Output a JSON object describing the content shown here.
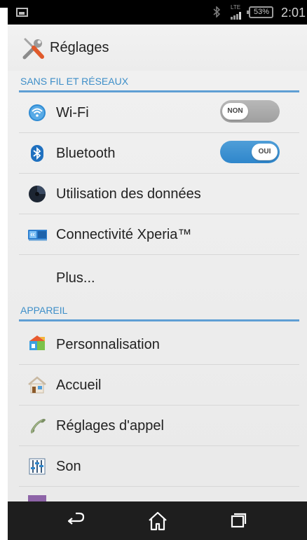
{
  "status_bar": {
    "network": "LTE",
    "battery": "53%",
    "time": "2:01"
  },
  "app_bar": {
    "title": "Réglages",
    "icon": "settings-tools-icon"
  },
  "sections": [
    {
      "header": "SANS FIL ET RÉSEAUX",
      "items": [
        {
          "label": "Wi-Fi",
          "icon": "wifi-icon",
          "toggle": "NON"
        },
        {
          "label": "Bluetooth",
          "icon": "bluetooth-icon",
          "toggle": "OUI"
        },
        {
          "label": "Utilisation des données",
          "icon": "data-usage-icon"
        },
        {
          "label": "Connectivité Xperia™",
          "icon": "xperia-connectivity-icon"
        },
        {
          "label": "Plus...",
          "icon": ""
        }
      ]
    },
    {
      "header": "APPAREIL",
      "items": [
        {
          "label": "Personnalisation",
          "icon": "personalization-icon"
        },
        {
          "label": "Accueil",
          "icon": "home-icon"
        },
        {
          "label": "Réglages d'appel",
          "icon": "phone-icon"
        },
        {
          "label": "Son",
          "icon": "sound-equalizer-icon"
        }
      ]
    }
  ],
  "nav_bar": {
    "back": "back-icon",
    "home": "home-nav-icon",
    "recents": "recents-icon"
  },
  "colors": {
    "accent": "#3d8ec8",
    "toggle_on": "#2f86cb",
    "toggle_off": "#a9a9a9",
    "nav_bg": "#1e1e1e"
  }
}
